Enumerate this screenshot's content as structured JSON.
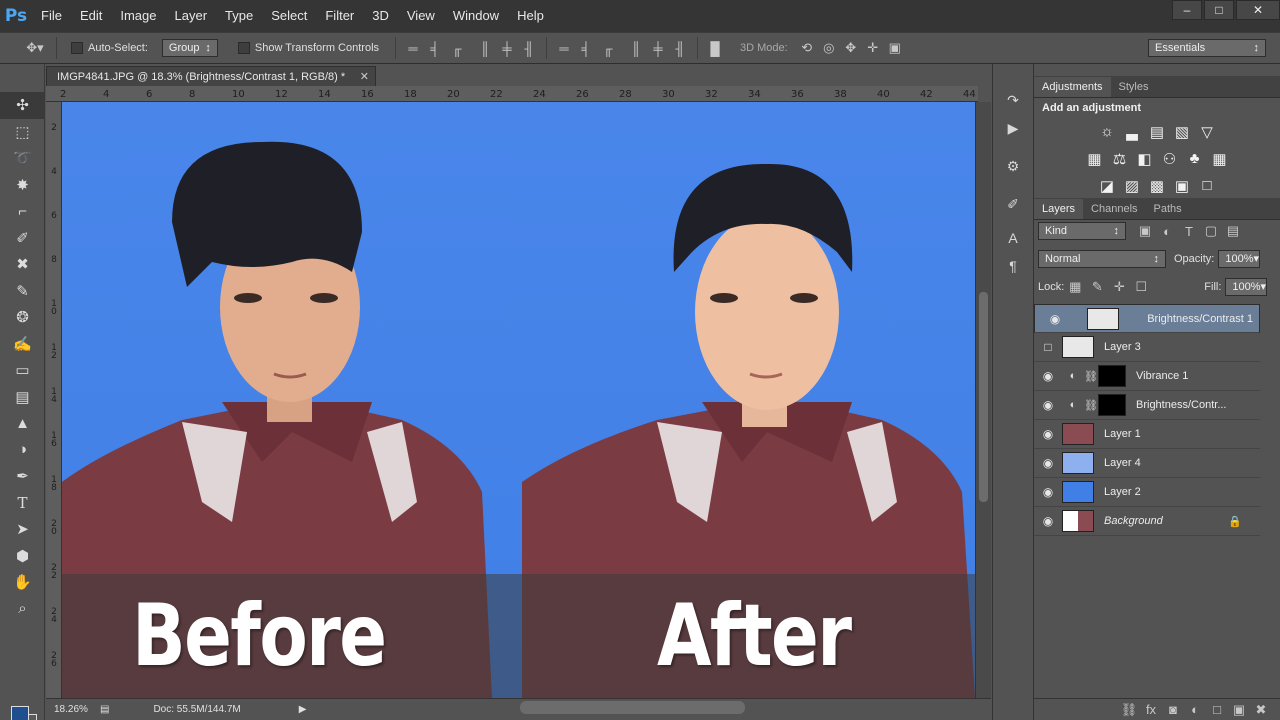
{
  "app": {
    "logo": "Ps"
  },
  "menu": [
    "File",
    "Edit",
    "Image",
    "Layer",
    "Type",
    "Select",
    "Filter",
    "3D",
    "View",
    "Window",
    "Help"
  ],
  "window_controls": {
    "minimize": "‒",
    "maximize": "□",
    "close": "✕"
  },
  "options_bar": {
    "auto_select_label": "Auto-Select:",
    "auto_select_value": "Group",
    "show_transform_label": "Show Transform Controls",
    "mode_3d_label": "3D Mode:",
    "workspace": "Essentials"
  },
  "document": {
    "tab_title": "IMGP4841.JPG @ 18.3% (Brightness/Contrast 1, RGB/8) *",
    "ruler_top": [
      "2",
      "4",
      "6",
      "8",
      "10",
      "12",
      "14",
      "16",
      "18",
      "20",
      "22",
      "24",
      "26",
      "28",
      "30",
      "32",
      "34",
      "36",
      "38",
      "40",
      "42",
      "44"
    ],
    "ruler_left": [
      "2",
      "4",
      "6",
      "8",
      "10",
      "12",
      "14",
      "16",
      "18",
      "20",
      "22",
      "24",
      "26"
    ],
    "before_label": "Before",
    "after_label": "After",
    "colors": {
      "background": "#4a86ea",
      "shirt": "#7a3b42",
      "skin": "#e2ad8e",
      "hair": "#1f2027"
    }
  },
  "status": {
    "zoom": "18.26%",
    "doc": "Doc: 55.5M/144.7M"
  },
  "panels": {
    "adjustments": {
      "tabs": [
        "Adjustments",
        "Styles"
      ],
      "title": "Add an adjustment",
      "rows": [
        [
          "☼",
          "▃",
          "▤",
          "▧",
          "▽"
        ],
        [
          "▦",
          "⚖",
          "◧",
          "⚇",
          "♣",
          "▦"
        ],
        [
          "◪",
          "▨",
          "▩",
          "▣",
          "□"
        ]
      ]
    },
    "layers": {
      "tabs": [
        "Layers",
        "Channels",
        "Paths"
      ],
      "filter": "Kind",
      "blend_mode": "Normal",
      "opacity_label": "Opacity:",
      "opacity": "100%",
      "lock_label": "Lock:",
      "fill_label": "Fill:",
      "fill": "100%",
      "items": [
        {
          "name": "Brightness/Contrast 1",
          "visible": true,
          "selected": true
        },
        {
          "name": "Layer 3",
          "visible": false,
          "selected": false
        },
        {
          "name": "Vibrance 1",
          "visible": true,
          "selected": false
        },
        {
          "name": "Brightness/Contr...",
          "visible": true,
          "selected": false
        },
        {
          "name": "Layer 1",
          "visible": true,
          "selected": false
        },
        {
          "name": "Layer 4",
          "visible": true,
          "selected": false
        },
        {
          "name": "Layer 2",
          "visible": true,
          "selected": false
        },
        {
          "name": "Background",
          "visible": true,
          "selected": false
        }
      ]
    }
  }
}
